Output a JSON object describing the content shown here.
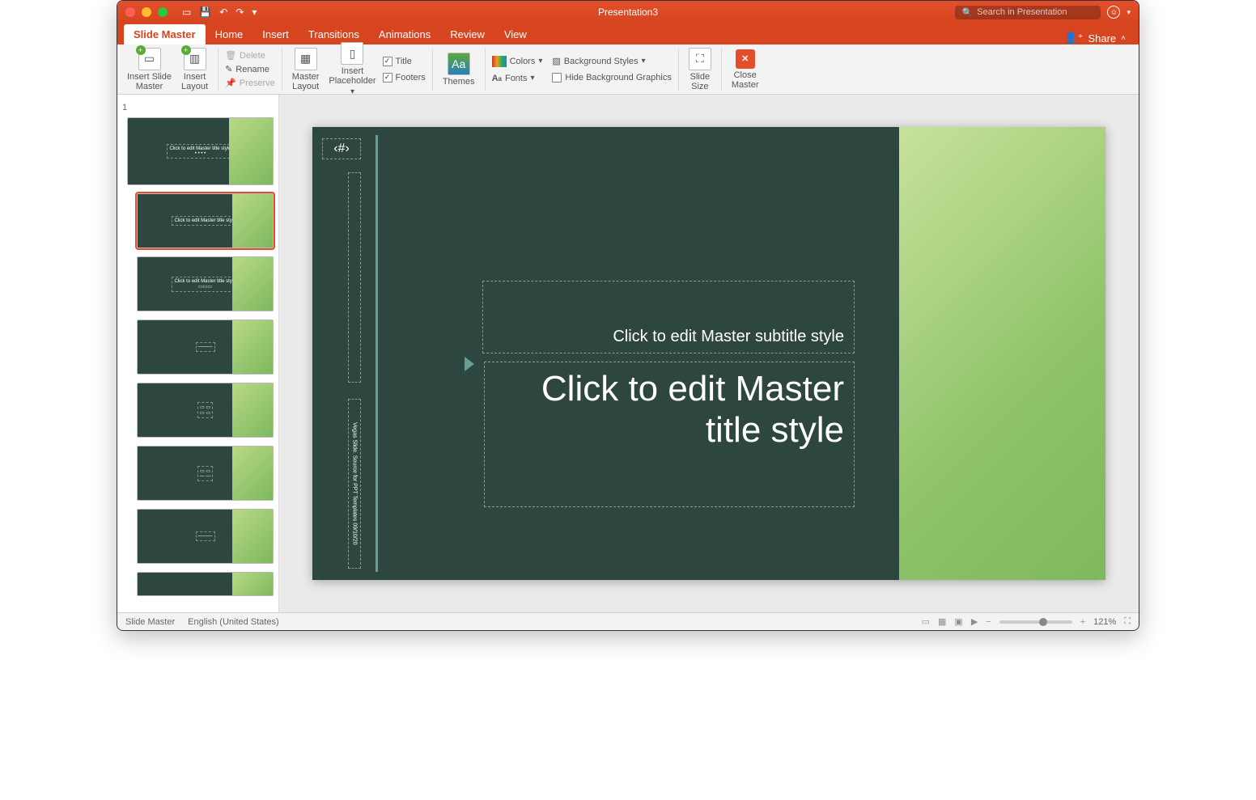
{
  "titlebar": {
    "document": "Presentation3",
    "search_placeholder": "Search in Presentation"
  },
  "tabs": [
    {
      "id": "slide-master",
      "label": "Slide Master",
      "active": true
    },
    {
      "id": "home",
      "label": "Home"
    },
    {
      "id": "insert",
      "label": "Insert"
    },
    {
      "id": "transitions",
      "label": "Transitions"
    },
    {
      "id": "animations",
      "label": "Animations"
    },
    {
      "id": "review",
      "label": "Review"
    },
    {
      "id": "view",
      "label": "View"
    }
  ],
  "share_label": "Share",
  "ribbon": {
    "insert_slide_master": "Insert Slide\nMaster",
    "insert_layout": "Insert\nLayout",
    "delete": "Delete",
    "rename": "Rename",
    "preserve": "Preserve",
    "master_layout": "Master\nLayout",
    "insert_placeholder": "Insert\nPlaceholder",
    "title_chk": "Title",
    "footers_chk": "Footers",
    "themes": "Themes",
    "colors": "Colors",
    "fonts": "Fonts",
    "background_styles": "Background Styles",
    "hide_bg_graphics": "Hide Background Graphics",
    "slide_size": "Slide\nSize",
    "close_master": "Close\nMaster"
  },
  "thumbs": {
    "master_num": "1",
    "layout2": {
      "title": "Click to edit Master title style"
    }
  },
  "slide": {
    "number_placeholder": "‹#›",
    "subtitle": "Click to edit Master subtitle style",
    "title": "Click to edit Master title style",
    "footer_text": "Vegas Slide. Source for PPT Templates  09/10/20"
  },
  "statusbar": {
    "view_name": "Slide Master",
    "language": "English (United States)",
    "zoom": "121%"
  },
  "colors": {
    "accent": "#d6451f",
    "slide_bg": "#2e4640",
    "slide_green": "#8ec36a"
  }
}
